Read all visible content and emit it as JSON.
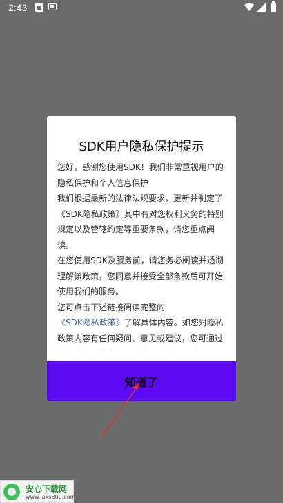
{
  "status_bar": {
    "time": "2:43"
  },
  "dialog": {
    "title": "SDK用户隐私保护提示",
    "paragraphs": [
      "您好，感谢您使用SDK！我们非常重视用户的隐私保护和个人信息保护",
      "我们根据最新的法律法规要求，更新并制定了《SDK隐私政策》其中有对您权利义务的特别规定以及管辖约定等重要条款，请您重点阅读。",
      "在您使用SDK及服务前，请您务必阅读并透彻理解该政策，您同意并接受全部条款后可开始使用我们的服务。"
    ],
    "link_paragraph": {
      "before": "您可点击下述链接阅读完整的",
      "link": "《SDK隐私政策》",
      "after": "了解具体内容。如您对隐私政策内容有任何疑问、意见或建议，您可通过我们官网下的客服联系电话与我们联系。"
    },
    "confirm_label": "知道了"
  },
  "watermark": {
    "brand": "安心下载网",
    "url": "www.jaxs800.com"
  },
  "colors": {
    "overlay": "#6b6b6b",
    "button": "#5b0af0",
    "link": "#4a6aa5",
    "annotation_arrow": "#e03030"
  }
}
